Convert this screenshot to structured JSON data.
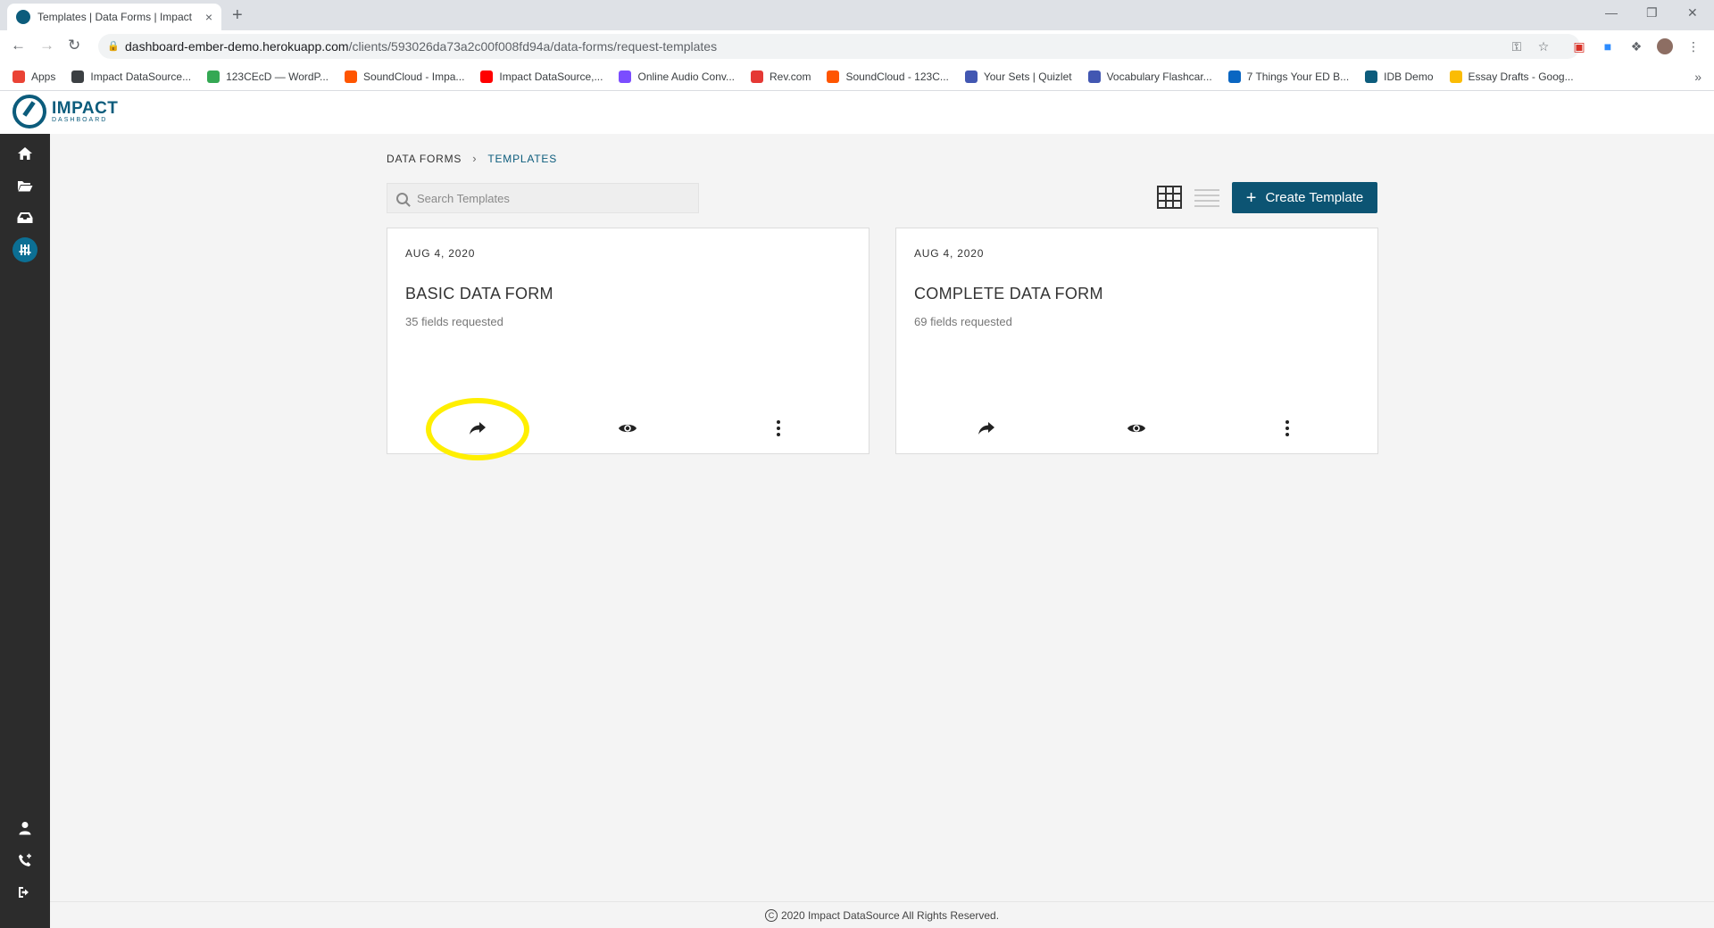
{
  "browser": {
    "tab_title": "Templates | Data Forms | Impact",
    "tab_close": "×",
    "new_tab": "+",
    "url_host": "dashboard-ember-demo.herokuapp.com",
    "url_path": "/clients/593026da73a2c00f008fd94a/data-forms/request-templates",
    "bookmarks": [
      {
        "label": "Apps",
        "color": "#ea4335"
      },
      {
        "label": "Impact DataSource...",
        "color": "#3c4043"
      },
      {
        "label": "123CEcD — WordP...",
        "color": "#34a853"
      },
      {
        "label": "SoundCloud - Impa...",
        "color": "#ff5500"
      },
      {
        "label": "Impact DataSource,...",
        "color": "#ff0000"
      },
      {
        "label": "Online Audio Conv...",
        "color": "#7b4dff"
      },
      {
        "label": "Rev.com",
        "color": "#e53935"
      },
      {
        "label": "SoundCloud - 123C...",
        "color": "#ff5500"
      },
      {
        "label": "Your Sets | Quizlet",
        "color": "#4257b2"
      },
      {
        "label": "Vocabulary Flashcar...",
        "color": "#4257b2"
      },
      {
        "label": "7 Things Your ED B...",
        "color": "#0a66c2"
      },
      {
        "label": "IDB Demo",
        "color": "#0c5c7c"
      },
      {
        "label": "Essay Drafts - Goog...",
        "color": "#fbbc04"
      }
    ]
  },
  "app": {
    "logo_line1": "IMPACT",
    "logo_line2": "DASHBOARD",
    "brand_color": "#0c5c7c"
  },
  "breadcrumb": {
    "parent": "DATA FORMS",
    "separator": "›",
    "current": "TEMPLATES"
  },
  "search": {
    "placeholder": "Search Templates",
    "value": ""
  },
  "create_button": {
    "plus": "+",
    "label": "Create Template"
  },
  "templates": [
    {
      "date": "AUG 4, 2020",
      "name": "BASIC DATA FORM",
      "fields": "35 fields requested"
    },
    {
      "date": "AUG 4, 2020",
      "name": "COMPLETE DATA FORM",
      "fields": "69 fields requested"
    }
  ],
  "footer": {
    "copyright_symbol": "C",
    "text": "2020 Impact DataSource All Rights Reserved."
  }
}
